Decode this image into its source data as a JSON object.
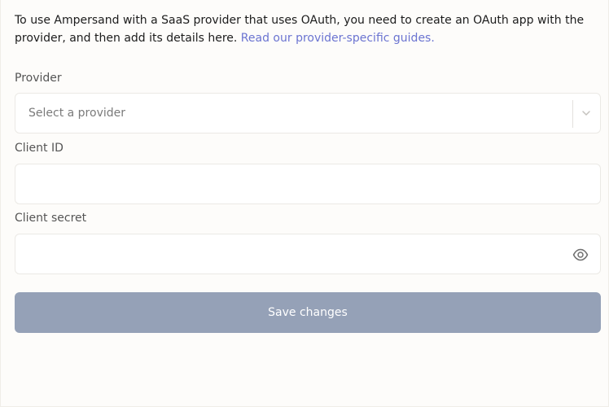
{
  "intro": {
    "text": "To use Ampersand with a SaaS provider that uses OAuth, you need to create an OAuth app with the provider, and then add its details here. ",
    "link": "Read our provider-specific guides."
  },
  "form": {
    "provider": {
      "label": "Provider",
      "placeholder": "Select a provider"
    },
    "client_id": {
      "label": "Client ID",
      "value": ""
    },
    "client_secret": {
      "label": "Client secret",
      "value": ""
    },
    "save_label": "Save changes"
  },
  "icons": {
    "select": "chevron-down-icon",
    "secret": "eye-icon"
  },
  "colors": {
    "link": "#6b74d1",
    "button_disabled": "#95a1b7"
  }
}
